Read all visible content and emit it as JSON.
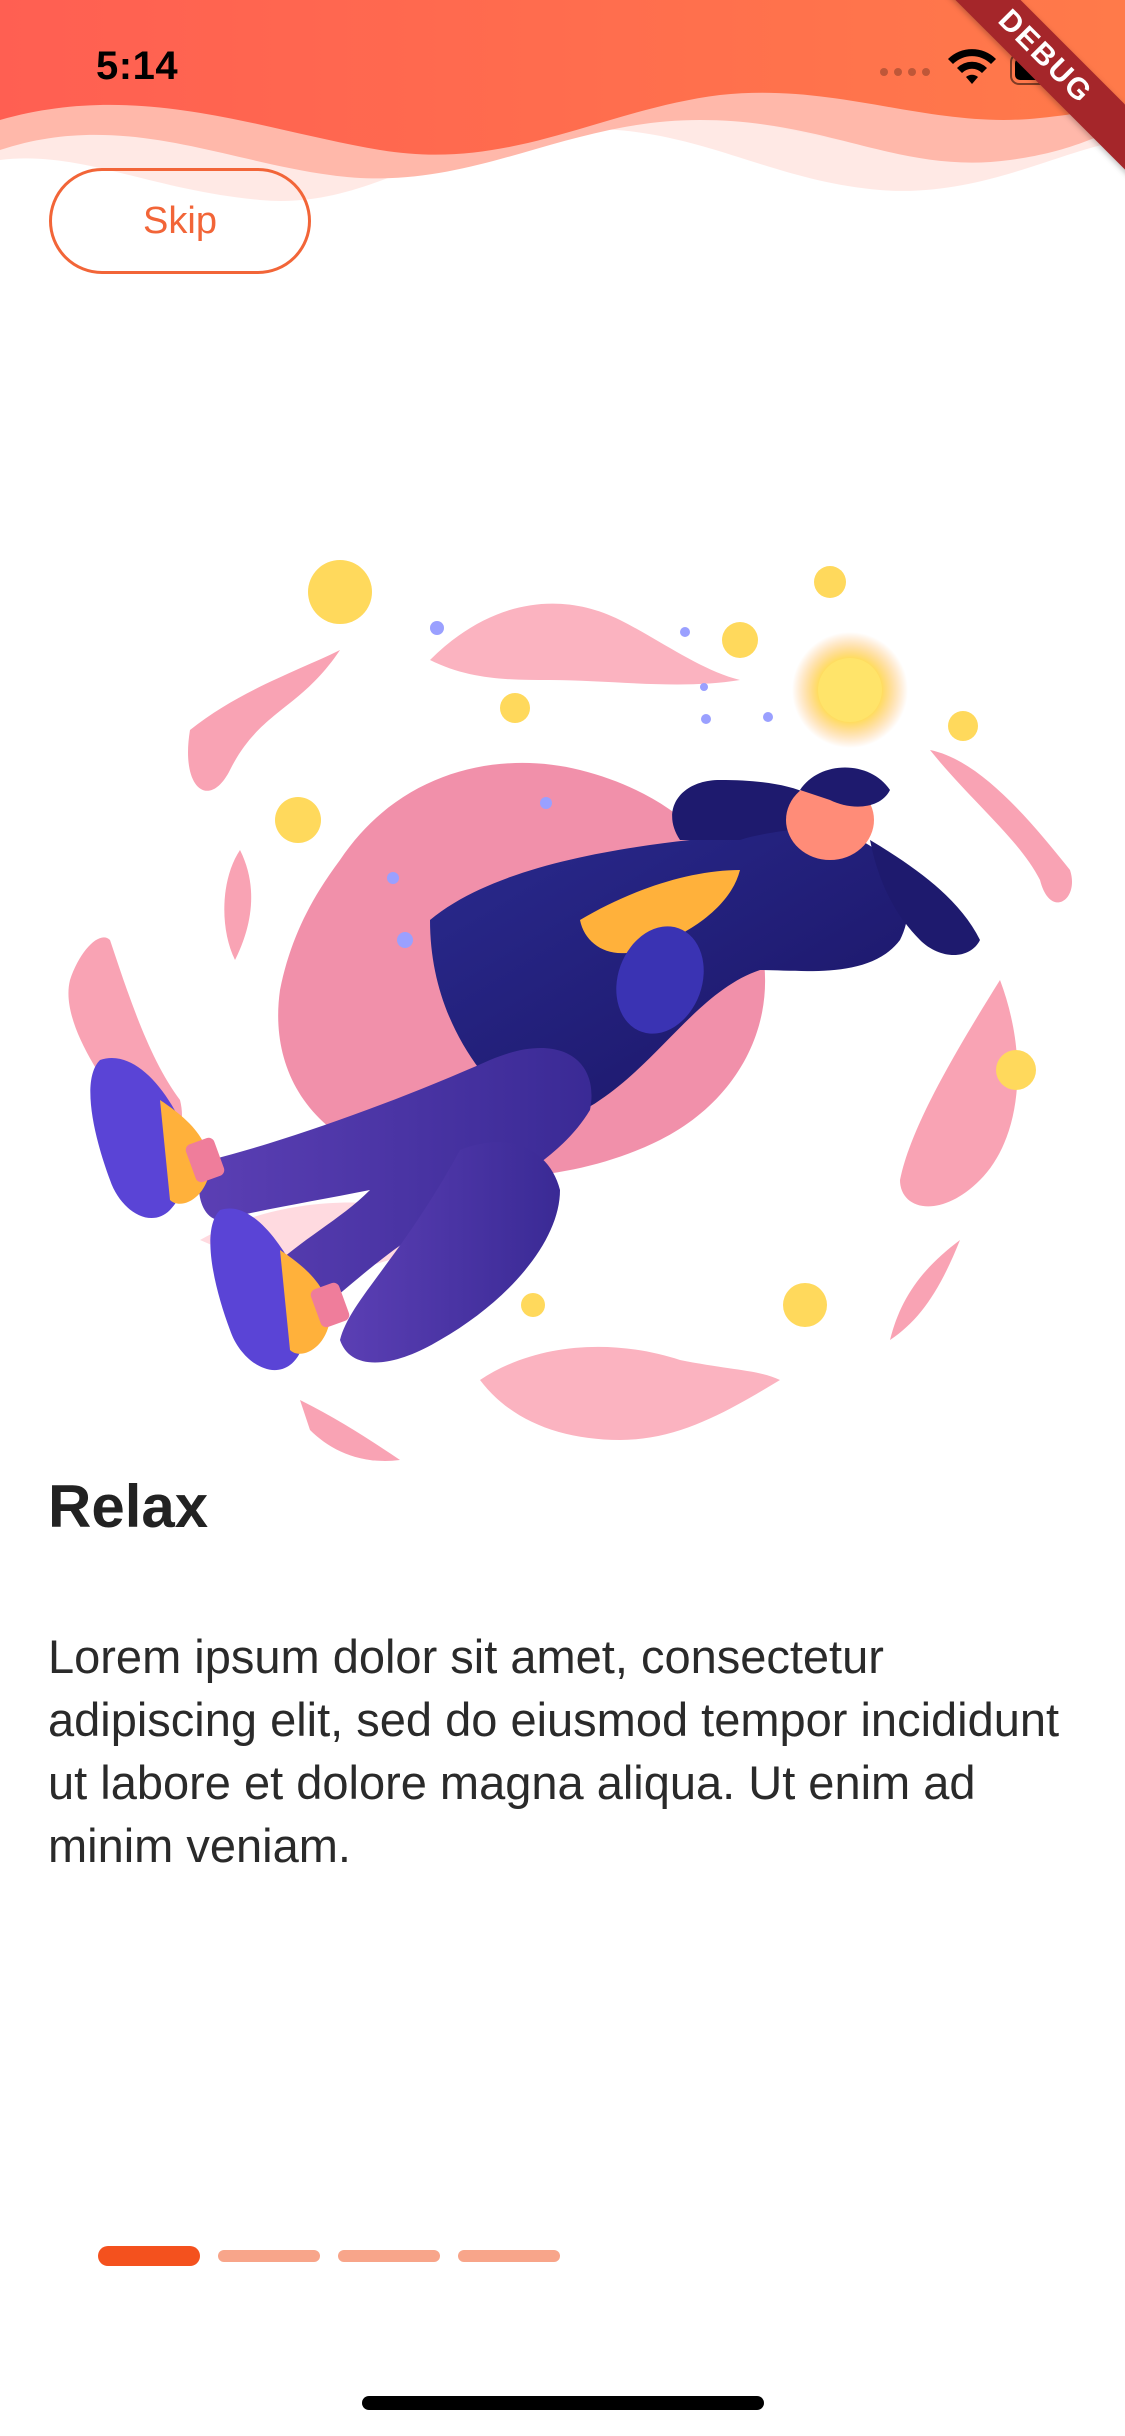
{
  "status_bar": {
    "time": "5:14",
    "debug_banner": "DEBUG"
  },
  "header": {
    "skip_label": "Skip"
  },
  "onboarding": {
    "title": "Relax",
    "description": "Lorem ipsum dolor sit amet, consectetur adipiscing elit, sed do eiusmod tempor incididunt ut labore et dolore magna aliqua. Ut enim ad minim veniam.",
    "illustration": "person-floating-relaxing-illustration"
  },
  "pager": {
    "page_count": 4,
    "current_page": 1
  },
  "colors": {
    "accent": "#f4511e",
    "wave_top": "#ff6a4d",
    "wave_light": "#ffd9d3",
    "indicator_inactive": "#f8a58a",
    "blob_pink": "#f9a3b4"
  }
}
